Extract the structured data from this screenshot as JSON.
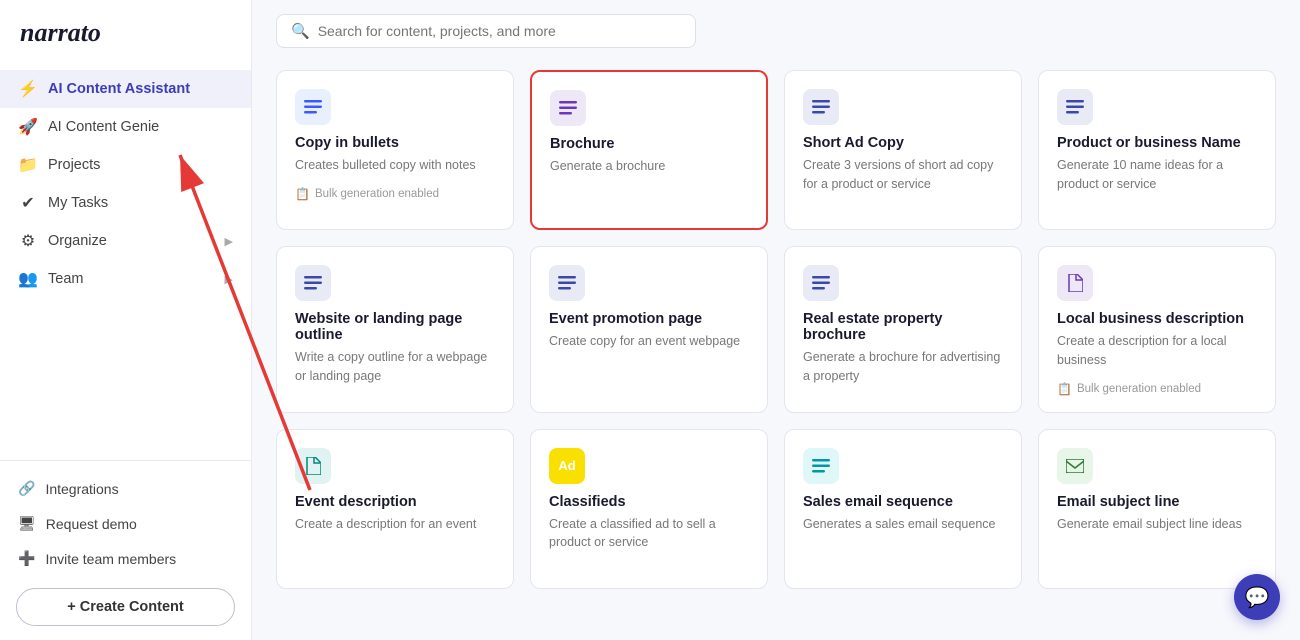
{
  "app": {
    "name": "narrato"
  },
  "sidebar": {
    "nav_items": [
      {
        "id": "ai-content-assistant",
        "label": "AI Content Assistant",
        "icon": "⚡",
        "active": true,
        "arrow": false
      },
      {
        "id": "ai-content-genie",
        "label": "AI Content Genie",
        "icon": "🚀",
        "active": false,
        "arrow": false
      },
      {
        "id": "projects",
        "label": "Projects",
        "icon": "📁",
        "active": false,
        "arrow": false
      },
      {
        "id": "my-tasks",
        "label": "My Tasks",
        "icon": "✔",
        "active": false,
        "arrow": false
      },
      {
        "id": "organize",
        "label": "Organize",
        "icon": "⚙",
        "active": false,
        "arrow": true
      },
      {
        "id": "team",
        "label": "Team",
        "icon": "👥",
        "active": false,
        "arrow": true
      }
    ],
    "bottom_items": [
      {
        "id": "integrations",
        "label": "Integrations",
        "icon": "🔗"
      },
      {
        "id": "request-demo",
        "label": "Request demo",
        "icon": "🖥"
      },
      {
        "id": "invite-team",
        "label": "Invite team members",
        "icon": "➕"
      }
    ],
    "create_button_label": "+ Create Content"
  },
  "search": {
    "placeholder": "Search for content, projects, and more"
  },
  "cards": [
    {
      "id": "copy-in-bullets",
      "title": "Copy in bullets",
      "description": "Creates bulleted copy with notes",
      "icon_type": "lines",
      "icon_color": "blue",
      "badge": "Bulk generation enabled",
      "highlighted": false
    },
    {
      "id": "brochure",
      "title": "Brochure",
      "description": "Generate a brochure",
      "icon_type": "lines",
      "icon_color": "purple",
      "badge": null,
      "highlighted": true
    },
    {
      "id": "short-ad-copy",
      "title": "Short Ad Copy",
      "description": "Create 3 versions of short ad copy for a product or service",
      "icon_type": "lines",
      "icon_color": "indigo",
      "badge": null,
      "highlighted": false
    },
    {
      "id": "product-business-name",
      "title": "Product or business Name",
      "description": "Generate 10 name ideas for a product or service",
      "icon_type": "lines",
      "icon_color": "indigo",
      "badge": null,
      "highlighted": false
    },
    {
      "id": "website-landing",
      "title": "Website or landing page outline",
      "description": "Write a copy outline for a webpage or landing page",
      "icon_type": "lines",
      "icon_color": "indigo",
      "badge": null,
      "highlighted": false
    },
    {
      "id": "event-promotion",
      "title": "Event promotion page",
      "description": "Create copy for an event webpage",
      "icon_type": "lines",
      "icon_color": "indigo",
      "badge": null,
      "highlighted": false
    },
    {
      "id": "real-estate",
      "title": "Real estate property brochure",
      "description": "Generate a brochure for advertising a property",
      "icon_type": "lines",
      "icon_color": "indigo",
      "badge": null,
      "highlighted": false
    },
    {
      "id": "local-business",
      "title": "Local business description",
      "description": "Create a description for a local business",
      "icon_type": "doc",
      "icon_color": "purple",
      "badge": "Bulk generation enabled",
      "highlighted": false
    },
    {
      "id": "event-description",
      "title": "Event description",
      "description": "Create a description for an event",
      "icon_type": "doc",
      "icon_color": "teal",
      "badge": null,
      "highlighted": false
    },
    {
      "id": "classifieds",
      "title": "Classifieds",
      "description": "Create a classified ad to sell a product or service",
      "icon_type": "ad",
      "icon_color": "yellow",
      "badge": null,
      "highlighted": false
    },
    {
      "id": "sales-email",
      "title": "Sales email sequence",
      "description": "Generates a sales email sequence",
      "icon_type": "lines",
      "icon_color": "cyan",
      "badge": null,
      "highlighted": false
    },
    {
      "id": "email-subject",
      "title": "Email subject line",
      "description": "Generate email subject line ideas",
      "icon_type": "email",
      "icon_color": "green",
      "badge": null,
      "highlighted": false
    }
  ]
}
